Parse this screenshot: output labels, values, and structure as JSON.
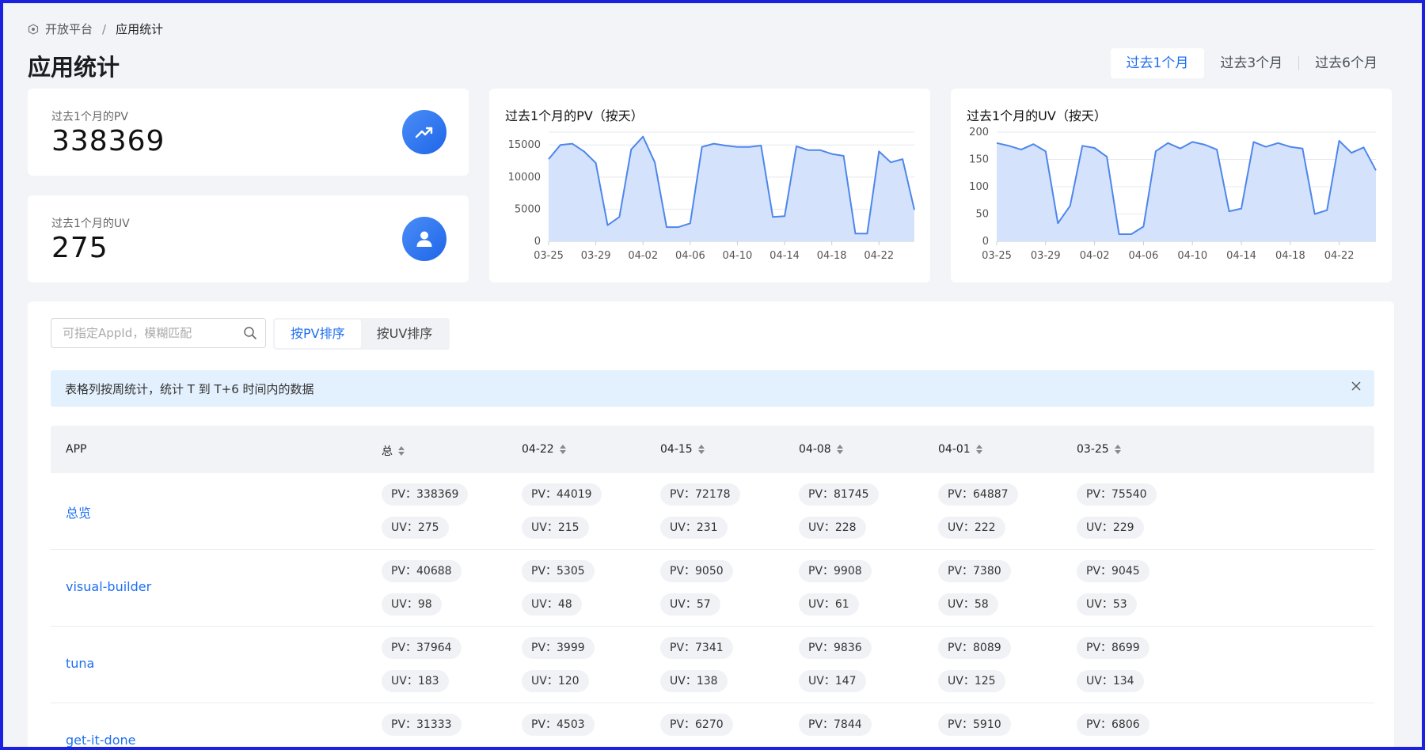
{
  "breadcrumb": {
    "root": "开放平台",
    "separator": "/",
    "current": "应用统计"
  },
  "page_title": "应用统计",
  "range_tabs": [
    "过去1个月",
    "过去3个月",
    "过去6个月"
  ],
  "active_range": 0,
  "stats": {
    "pv": {
      "label": "过去1个月的PV",
      "value": "338369"
    },
    "uv": {
      "label": "过去1个月的UV",
      "value": "275"
    }
  },
  "colors": {
    "accent": "#1e6ff1",
    "area_fill": "#d4e3fb",
    "line": "#4e86ec"
  },
  "chart_data": [
    {
      "type": "area",
      "title": "过去1个月的PV（按天）",
      "x": [
        "03-25",
        "03-26",
        "03-27",
        "03-28",
        "03-29",
        "03-30",
        "03-31",
        "04-01",
        "04-02",
        "04-03",
        "04-04",
        "04-05",
        "04-06",
        "04-07",
        "04-08",
        "04-09",
        "04-10",
        "04-11",
        "04-12",
        "04-13",
        "04-14",
        "04-15",
        "04-16",
        "04-17",
        "04-18",
        "04-19",
        "04-20",
        "04-21",
        "04-22",
        "04-23",
        "04-24"
      ],
      "x_ticks": [
        "03-25",
        "03-29",
        "04-02",
        "04-06",
        "04-10",
        "04-14",
        "04-18",
        "04-22"
      ],
      "values": [
        12800,
        15000,
        15200,
        14000,
        12200,
        2500,
        3800,
        14300,
        16300,
        12300,
        2200,
        2200,
        2800,
        14700,
        15200,
        14900,
        14700,
        14700,
        14900,
        3800,
        3900,
        14800,
        14200,
        14200,
        13600,
        13300,
        1200,
        1200,
        14000,
        12300,
        12800,
        4900
      ],
      "ylim": [
        0,
        17000
      ],
      "y_ticks": [
        0,
        5000,
        10000,
        15000
      ],
      "grid": true
    },
    {
      "type": "area",
      "title": "过去1个月的UV（按天）",
      "x": [
        "03-25",
        "03-26",
        "03-27",
        "03-28",
        "03-29",
        "03-30",
        "03-31",
        "04-01",
        "04-02",
        "04-03",
        "04-04",
        "04-05",
        "04-06",
        "04-07",
        "04-08",
        "04-09",
        "04-10",
        "04-11",
        "04-12",
        "04-13",
        "04-14",
        "04-15",
        "04-16",
        "04-17",
        "04-18",
        "04-19",
        "04-20",
        "04-21",
        "04-22",
        "04-23",
        "04-24"
      ],
      "x_ticks": [
        "03-25",
        "03-29",
        "04-02",
        "04-06",
        "04-10",
        "04-14",
        "04-18",
        "04-22"
      ],
      "values": [
        180,
        175,
        168,
        178,
        165,
        33,
        65,
        175,
        171,
        155,
        13,
        13,
        27,
        165,
        180,
        170,
        182,
        177,
        168,
        55,
        60,
        182,
        173,
        180,
        173,
        170,
        50,
        57,
        184,
        162,
        172,
        130
      ],
      "ylim": [
        0,
        200
      ],
      "y_ticks": [
        0,
        50,
        100,
        150,
        200
      ],
      "grid": true
    }
  ],
  "toolbar": {
    "search_placeholder": "可指定AppId，模糊匹配",
    "sort_buttons": [
      "按PV排序",
      "按UV排序"
    ],
    "active_sort": 0
  },
  "notice": "表格列按周统计，统计 T 到 T+6 时间内的数据",
  "table": {
    "columns": [
      "APP",
      "总",
      "04-22",
      "04-15",
      "04-08",
      "04-01",
      "03-25"
    ],
    "rows": [
      {
        "app": "总览",
        "pv": [
          "PV：338369",
          "PV：44019",
          "PV：72178",
          "PV：81745",
          "PV：64887",
          "PV：75540"
        ],
        "uv": [
          "UV：275",
          "UV：215",
          "UV：231",
          "UV：228",
          "UV：222",
          "UV：229"
        ]
      },
      {
        "app": "visual-builder",
        "pv": [
          "PV：40688",
          "PV：5305",
          "PV：9050",
          "PV：9908",
          "PV：7380",
          "PV：9045"
        ],
        "uv": [
          "UV：98",
          "UV：48",
          "UV：57",
          "UV：61",
          "UV：58",
          "UV：53"
        ]
      },
      {
        "app": "tuna",
        "pv": [
          "PV：37964",
          "PV：3999",
          "PV：7341",
          "PV：9836",
          "PV：8089",
          "PV：8699"
        ],
        "uv": [
          "UV：183",
          "UV：120",
          "UV：138",
          "UV：147",
          "UV：125",
          "UV：134"
        ]
      },
      {
        "app": "get-it-done",
        "pv": [
          "PV：31333",
          "PV：4503",
          "PV：6270",
          "PV：7844",
          "PV：5910",
          "PV：6806"
        ],
        "uv": [
          "",
          "",
          "",
          "",
          "",
          ""
        ]
      }
    ]
  }
}
